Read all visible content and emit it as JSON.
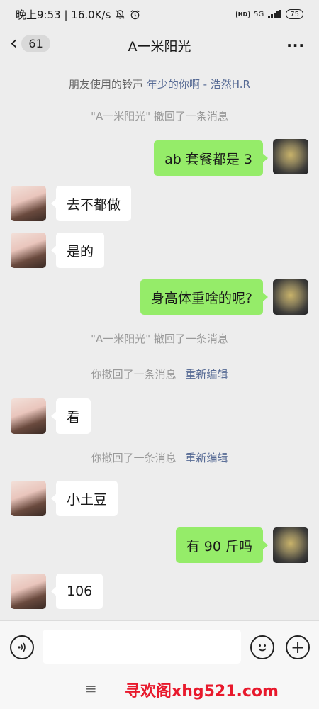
{
  "status_bar": {
    "time_speed": "晚上9:53 | 16.0K/s",
    "mute_icon": "bell-off-icon",
    "alarm_icon": "alarm-icon",
    "hd": "HD",
    "network": "5G",
    "battery": "75"
  },
  "header": {
    "unread_count": "61",
    "title": "A一米阳光",
    "more": "···"
  },
  "messages": {
    "ringtone_prefix": "朋友使用的铃声",
    "ringtone_song": "年少的你啊 - 浩然H.R",
    "recall_1": "\"A一米阳光\" 撤回了一条消息",
    "msg_1": "ab 套餐都是 3",
    "msg_2": "去不都做",
    "msg_3": "是的",
    "msg_4": "身高体重啥的呢?",
    "recall_2": "\"A一米阳光\" 撤回了一条消息",
    "self_recall_1": "你撤回了一条消息",
    "reedit_1": "重新编辑",
    "msg_5": "看",
    "self_recall_2": "你撤回了一条消息",
    "reedit_2": "重新编辑",
    "msg_6": "小土豆",
    "msg_7": "有 90 斤吗",
    "msg_8": "106"
  },
  "input_bar": {
    "voice_icon": "voice-icon",
    "emoji_icon": "emoji-icon",
    "plus_icon": "plus-icon"
  },
  "bottom": {
    "menu_glyph": "≡",
    "watermark": "寻欢阁xhg521.com"
  },
  "colors": {
    "background": "#ededed",
    "bubble_self": "#95ec69",
    "bubble_other": "#ffffff",
    "link": "#576b95",
    "watermark": "#e8192c"
  }
}
